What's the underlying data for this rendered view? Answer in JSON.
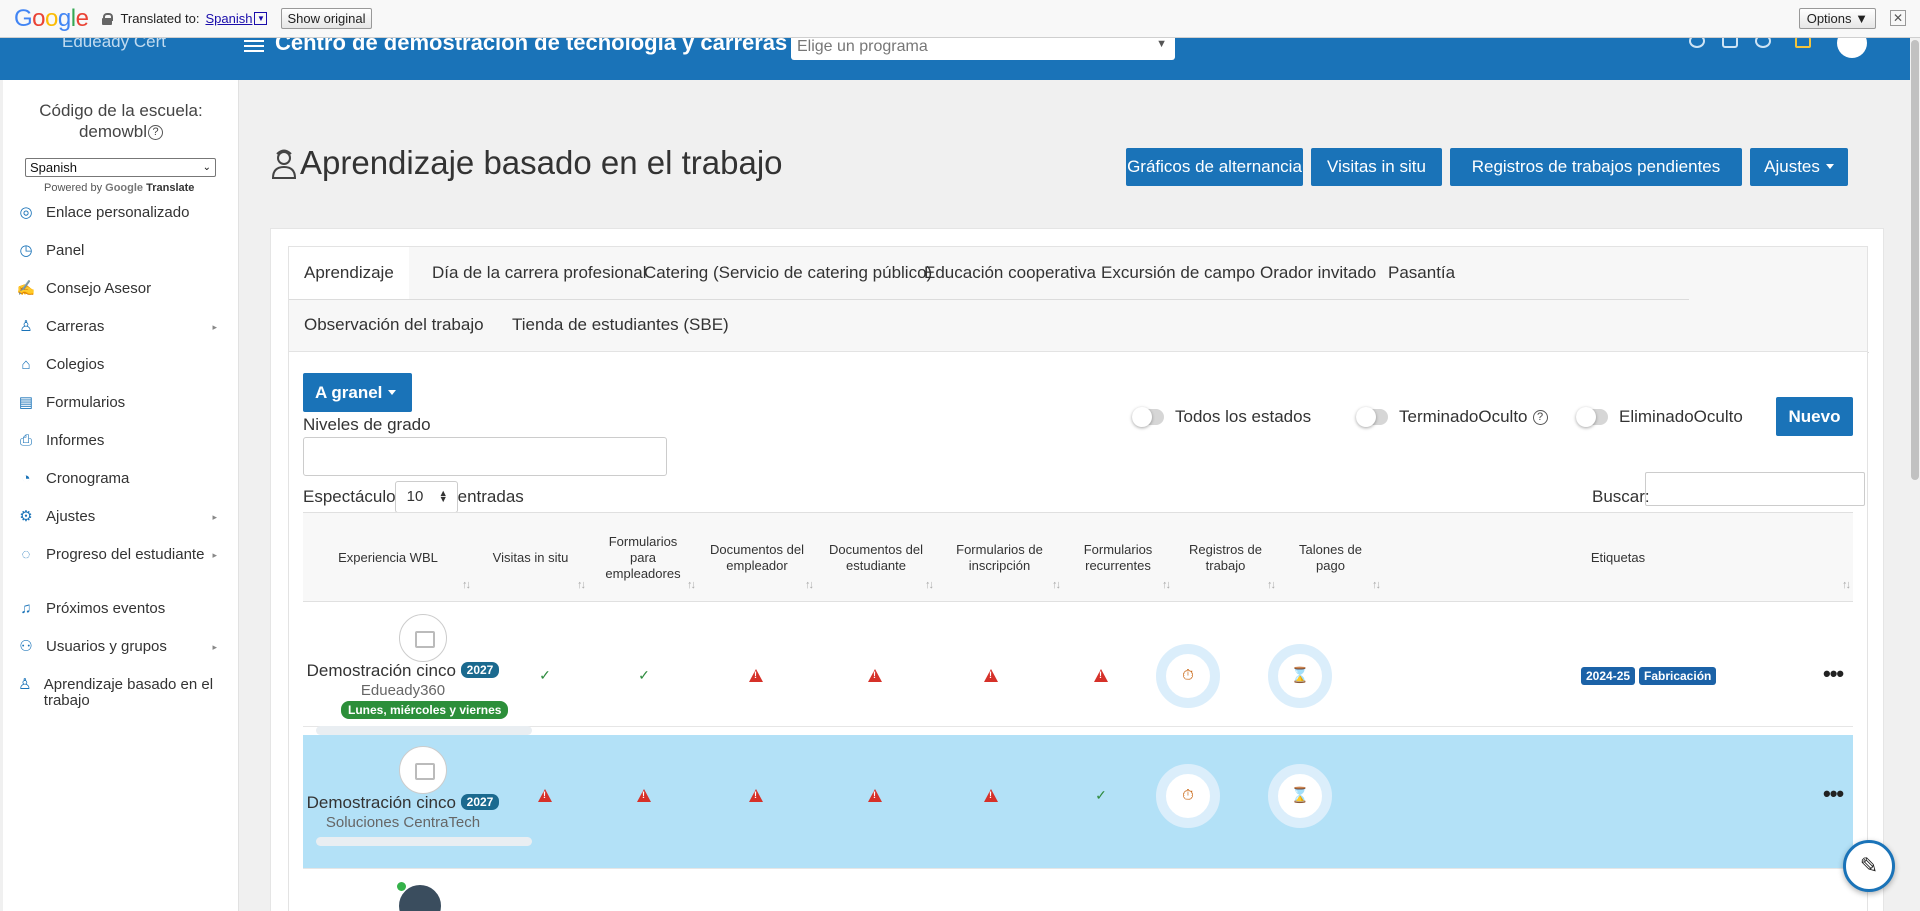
{
  "google_bar": {
    "logo": [
      "G",
      "o",
      "o",
      "g",
      "l",
      "e"
    ],
    "translated_to": "Translated to:",
    "language": "Spanish",
    "show_original": "Show original",
    "options": "Options ▼",
    "close": "✕"
  },
  "topnav": {
    "title": "Centro de demostración de tecnología y carreras",
    "program_placeholder": "Elige un programa"
  },
  "sidebar": {
    "school_code_label": "Código de la escuela:",
    "school_code": "demowbl",
    "help": "?",
    "language_select": "Spanish",
    "powered_by": "Powered by",
    "google_word": "Google",
    "translate_word": "Translate",
    "items": [
      {
        "label": "Enlace personalizado",
        "icon": "globe-icon",
        "glyph": "◎"
      },
      {
        "label": "Panel",
        "icon": "dashboard-icon",
        "glyph": "◷"
      },
      {
        "label": "Consejo Asesor",
        "icon": "handshake-icon",
        "glyph": "✍"
      },
      {
        "label": "Carreras",
        "icon": "person-badge-icon",
        "glyph": "♙",
        "caret": "▸"
      },
      {
        "label": "Colegios",
        "icon": "graduation-cap-icon",
        "glyph": "⌂"
      },
      {
        "label": "Formularios",
        "icon": "form-icon",
        "glyph": "▤"
      },
      {
        "label": "Informes",
        "icon": "printer-icon",
        "glyph": "⎙"
      },
      {
        "label": "Cronograma",
        "icon": "clock-icon",
        "glyph": "◔"
      },
      {
        "label": "Ajustes",
        "icon": "gears-icon",
        "glyph": "⚙",
        "caret": "▸"
      },
      {
        "label": "Progreso del estudiante",
        "icon": "progress-icon",
        "glyph": "◌",
        "caret": "▸"
      },
      {
        "label": "Próximos eventos",
        "icon": "bell-icon",
        "glyph": "♫"
      },
      {
        "label": "Usuarios y grupos",
        "icon": "users-icon",
        "glyph": "⚇",
        "caret": "▸"
      },
      {
        "label": "Aprendizaje basado en el trabajo",
        "icon": "worker-icon",
        "glyph": "♙"
      }
    ]
  },
  "page": {
    "title": "Aprendizaje basado en el trabajo",
    "buttons": {
      "charts": "Gráficos de alternancia",
      "visits": "Visitas in situ",
      "pending": "Registros de trabajos pendientes",
      "settings": "Ajustes"
    }
  },
  "tabs": [
    "Aprendizaje",
    "Día de la carrera profesional",
    "Catering (Servicio de catering público)",
    "Educación cooperativa",
    "Excursión de campo",
    "Orador invitado",
    "Pasantía",
    "Observación del trabajo",
    "Tienda de estudiantes (SBE)"
  ],
  "controls": {
    "bulk": "A granel",
    "grade_levels": "Niveles de grado",
    "show": "Espectáculo",
    "entries_value": "10",
    "entries": "entradas",
    "search": "Buscar:",
    "toggle_all_states": "Todos los estados",
    "toggle_finished": "TerminadoOculto",
    "toggle_deleted": "EliminadoOculto",
    "new": "Nuevo",
    "help": "?"
  },
  "table": {
    "columns": [
      "Experiencia WBL",
      "Visitas in situ",
      "Formularios para empleadores",
      "Documentos del empleador",
      "Documentos del estudiante",
      "Formularios de inscripción",
      "Formularios recurrentes",
      "Registros de trabajo",
      "Talones de pago",
      "Etiquetas"
    ],
    "sort_glyph": "↑↓",
    "rows": [
      {
        "name": "Demostración cinco",
        "year": "2027",
        "company": "Edueady360",
        "days": "Lunes, miércoles y viernes",
        "statuses": [
          "check",
          "check",
          "warn",
          "warn",
          "warn",
          "warn"
        ],
        "worklog_icon": "⏱",
        "paystub_icon": "⌛",
        "tags": [
          "2024-25",
          "Fabricación"
        ],
        "menu": "•••"
      },
      {
        "name": "Demostración cinco",
        "year": "2027",
        "company": "Soluciones CentraTech",
        "statuses": [
          "warn",
          "warn",
          "warn",
          "warn",
          "warn",
          "check"
        ],
        "worklog_icon": "⏱",
        "paystub_icon": "⌛",
        "tags": [],
        "menu": "•••"
      }
    ]
  },
  "check_glyph": "✓",
  "fab_icon": "✎"
}
